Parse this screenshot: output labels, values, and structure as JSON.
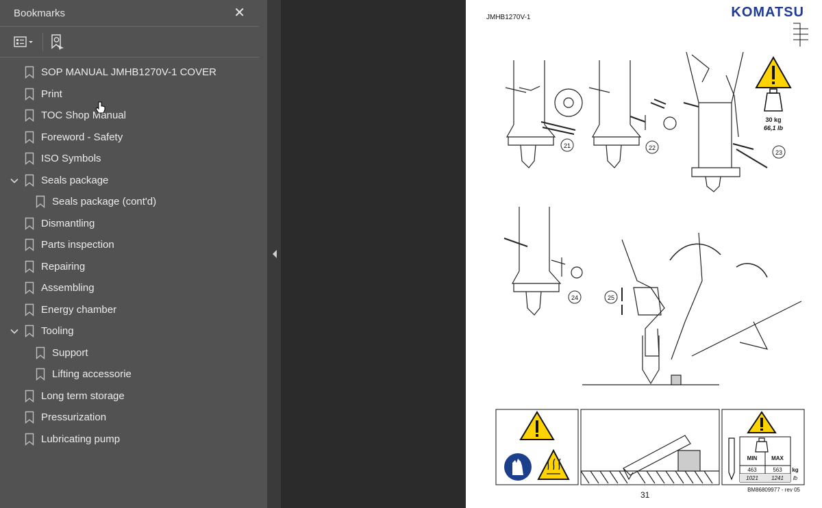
{
  "panel": {
    "title": "Bookmarks",
    "close_icon": "close-icon",
    "toolbar": {
      "options_icon": "list-options-icon",
      "find_icon": "find-bookmark-icon"
    }
  },
  "bookmarks": [
    {
      "label": "SOP MANUAL JMHB1270V-1 COVER",
      "level": 0,
      "expanded": null
    },
    {
      "label": "Print",
      "level": 0,
      "expanded": null
    },
    {
      "label": "TOC Shop Manual",
      "level": 0,
      "expanded": null
    },
    {
      "label": "Foreword - Safety",
      "level": 0,
      "expanded": null
    },
    {
      "label": "ISO Symbols",
      "level": 0,
      "expanded": null
    },
    {
      "label": "Seals package",
      "level": 0,
      "expanded": true
    },
    {
      "label": "Seals package (cont'd)",
      "level": 1,
      "expanded": null
    },
    {
      "label": "Dismantling",
      "level": 0,
      "expanded": null
    },
    {
      "label": "Parts inspection",
      "level": 0,
      "expanded": null
    },
    {
      "label": "Repairing",
      "level": 0,
      "expanded": null
    },
    {
      "label": "Assembling",
      "level": 0,
      "expanded": null
    },
    {
      "label": "Energy chamber",
      "level": 0,
      "expanded": null
    },
    {
      "label": "Tooling",
      "level": 0,
      "expanded": true
    },
    {
      "label": "Support",
      "level": 1,
      "expanded": null
    },
    {
      "label": "Lifting accessorie",
      "level": 1,
      "expanded": null
    },
    {
      "label": "Long term storage",
      "level": 0,
      "expanded": null
    },
    {
      "label": "Pressurization",
      "level": 0,
      "expanded": null
    },
    {
      "label": "Lubricating pump",
      "level": 0,
      "expanded": null
    }
  ],
  "page": {
    "doc_code": "JMHB1270V-1",
    "brand": "KOMATSU",
    "page_number": "31",
    "doc_ref": "BM86809977 - rev 05",
    "steps": [
      "21",
      "22",
      "23",
      "24",
      "25"
    ],
    "weight_kg": "30 kg",
    "weight_lb": "66,1 lb",
    "table": {
      "headers": [
        "MIN",
        "MAX"
      ],
      "kg": [
        "463",
        "563"
      ],
      "lb": [
        "1021",
        "1241"
      ],
      "unit_kg": "kg",
      "unit_lb": "lb"
    }
  },
  "colors": {
    "panel_bg": "#525252",
    "accent_warning": "#ffd400",
    "brand": "#1f3a93"
  }
}
